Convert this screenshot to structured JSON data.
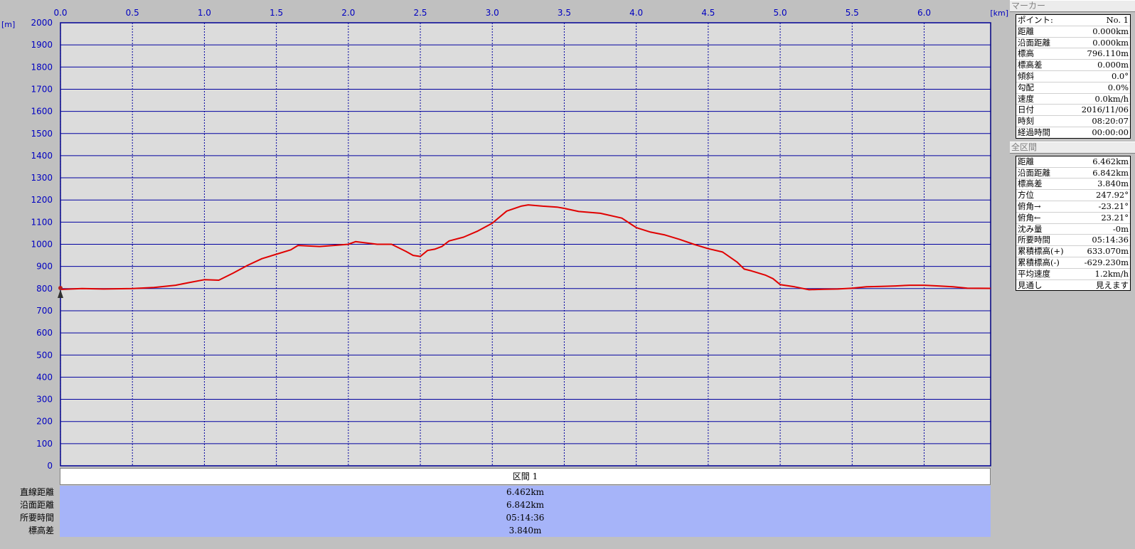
{
  "chart_data": {
    "type": "line",
    "x_unit": "[km]",
    "y_unit": "[m]",
    "xlim": [
      0,
      6.462
    ],
    "ylim": [
      0,
      2000
    ],
    "x_ticks": [
      "0.0",
      "0.5",
      "1.0",
      "1.5",
      "2.0",
      "2.5",
      "3.0",
      "3.5",
      "4.0",
      "4.5",
      "5.0",
      "5.5",
      "6.0"
    ],
    "x_tick_values": [
      0,
      0.5,
      1.0,
      1.5,
      2.0,
      2.5,
      3.0,
      3.5,
      4.0,
      4.5,
      5.0,
      5.5,
      6.0
    ],
    "y_ticks": [
      "2000",
      "1900",
      "1800",
      "1700",
      "1600",
      "1500",
      "1400",
      "1300",
      "1200",
      "1100",
      "1000",
      "900",
      "800",
      "700",
      "600",
      "500",
      "400",
      "300",
      "200",
      "100",
      "0"
    ],
    "y_tick_values": [
      2000,
      1900,
      1800,
      1700,
      1600,
      1500,
      1400,
      1300,
      1200,
      1100,
      1000,
      900,
      800,
      700,
      600,
      500,
      400,
      300,
      200,
      100,
      0
    ],
    "grid": true,
    "colors": {
      "plot_bg": "#dcdcdc",
      "grid": "#0000a0",
      "line": "#e00000",
      "tick_text": "#0000c0",
      "frame": "#000080"
    },
    "series": [
      {
        "x": [
          0,
          0.15,
          0.3,
          0.5,
          0.65,
          0.8,
          0.9,
          1.0,
          1.1,
          1.2,
          1.3,
          1.4,
          1.5,
          1.6,
          1.65,
          1.8,
          1.9,
          2.0,
          2.05,
          2.2,
          2.3,
          2.4,
          2.45,
          2.5,
          2.55,
          2.6,
          2.65,
          2.7,
          2.8,
          2.9,
          3.0,
          3.1,
          3.2,
          3.25,
          3.35,
          3.45,
          3.5,
          3.6,
          3.75,
          3.9,
          4.0,
          4.1,
          4.2,
          4.3,
          4.4,
          4.5,
          4.6,
          4.7,
          4.75,
          4.8,
          4.9,
          4.95,
          5.0,
          5.1,
          5.2,
          5.3,
          5.4,
          5.5,
          5.6,
          5.7,
          5.8,
          5.9,
          6.0,
          6.1,
          6.2,
          6.3,
          6.462
        ],
        "y": [
          796,
          800,
          798,
          800,
          805,
          815,
          828,
          840,
          838,
          870,
          905,
          935,
          955,
          975,
          995,
          990,
          995,
          1000,
          1012,
          1000,
          1000,
          968,
          950,
          945,
          972,
          978,
          990,
          1015,
          1032,
          1060,
          1095,
          1150,
          1172,
          1178,
          1172,
          1168,
          1162,
          1148,
          1140,
          1118,
          1075,
          1055,
          1042,
          1022,
          1000,
          980,
          965,
          920,
          888,
          880,
          860,
          845,
          818,
          808,
          795,
          797,
          798,
          802,
          808,
          810,
          812,
          815,
          815,
          812,
          808,
          802,
          801
        ]
      }
    ]
  },
  "segment_table": {
    "header": "区間 1",
    "row_labels": [
      "直線距離",
      "沿面距離",
      "所要時間",
      "標高差"
    ],
    "values": [
      "6.462km",
      "6.842km",
      "05:14:36",
      "3.840m"
    ]
  },
  "marker_panel": {
    "title": "マーカー",
    "rows": [
      {
        "label": "ポイント:",
        "value": "No. 1"
      },
      {
        "label": "距離",
        "value": "0.000km"
      },
      {
        "label": "沿面距離",
        "value": "0.000km"
      },
      {
        "label": "標高",
        "value": "796.110m"
      },
      {
        "label": "標高差",
        "value": "0.000m"
      },
      {
        "label": "傾斜",
        "value": "0.0°"
      },
      {
        "label": "勾配",
        "value": "0.0%"
      },
      {
        "label": "速度",
        "value": "0.0km/h"
      },
      {
        "label": "日付",
        "value": "2016/11/06"
      },
      {
        "label": "時刻",
        "value": "08:20:07"
      },
      {
        "label": "経過時間",
        "value": "00:00:00"
      }
    ]
  },
  "total_panel": {
    "title": "全区間",
    "rows": [
      {
        "label": "距離",
        "value": "6.462km"
      },
      {
        "label": "沿面距離",
        "value": "6.842km"
      },
      {
        "label": "標高差",
        "value": "3.840m"
      },
      {
        "label": "方位",
        "value": "247.92°"
      },
      {
        "label": "俯角→",
        "value": "-23.21°"
      },
      {
        "label": "俯角←",
        "value": "23.21°"
      },
      {
        "label": "沈み量",
        "value": "-0m"
      },
      {
        "label": "所要時間",
        "value": "05:14:36"
      },
      {
        "label": "累積標高(+)",
        "value": "633.070m"
      },
      {
        "label": "累積標高(-)",
        "value": "-629.230m"
      },
      {
        "label": "平均速度",
        "value": "1.2km/h"
      },
      {
        "label": "見通し",
        "value": "見えます"
      }
    ]
  }
}
